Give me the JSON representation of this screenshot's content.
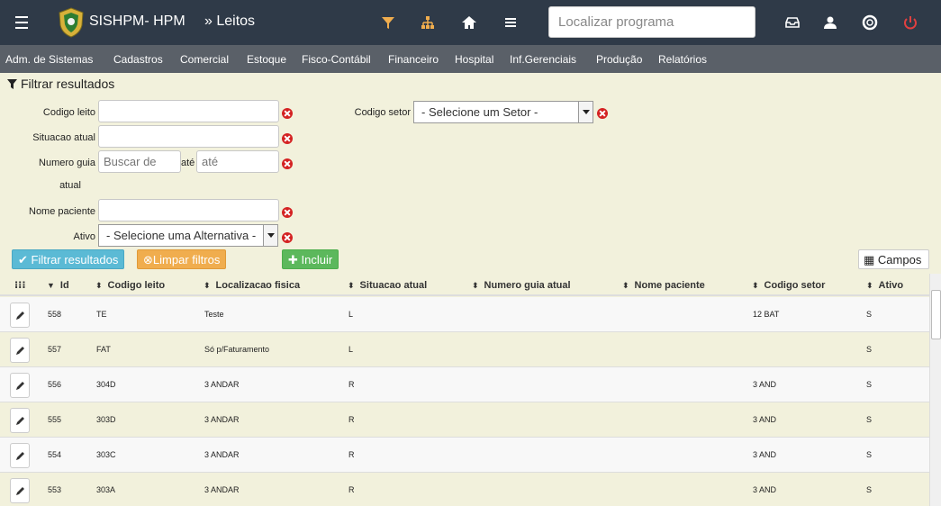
{
  "app": {
    "title": "SISHPM- HPM",
    "breadcrumb": "» Leitos"
  },
  "topbar": {
    "search_placeholder": "Localizar programa",
    "icons": [
      "filter-icon",
      "sitemap-icon",
      "home-icon",
      "list-icon",
      "inbox-icon",
      "user-icon",
      "lifebuoy-icon",
      "power-icon"
    ],
    "colors": {
      "bar": "#2f3a48",
      "accent": "#f0ad4e",
      "power": "#e04040"
    }
  },
  "nav": [
    "Adm. de Sistemas",
    "Cadastros",
    "Comercial",
    "Estoque",
    "Fisco-Contábil",
    "Financeiro",
    "Hospital",
    "Inf.Gerenciais",
    "Produção",
    "Relatórios"
  ],
  "filter": {
    "title": "Filtrar resultados",
    "codigo_leito": "Codigo leito",
    "situacao_atual": "Situacao atual",
    "numero_guia": "Numero guia",
    "numero_guia_2": "atual",
    "buscar_de_placeholder": "Buscar de",
    "ate_label": "até",
    "ate_placeholder": "até",
    "nome_paciente": "Nome paciente",
    "ativo": "Ativo",
    "ativo_select": "- Selecione uma Alternativa -",
    "codigo_setor": "Codigo setor",
    "setor_select": "- Selecione um Setor -"
  },
  "buttons": {
    "filtrar": "Filtrar resultados",
    "limpar": "Limpar filtros",
    "incluir": "Incluir",
    "campos": "Campos"
  },
  "table": {
    "headers": [
      "Id",
      "Codigo leito",
      "Localizacao fisica",
      "Situacao atual",
      "Numero guia atual",
      "Nome paciente",
      "Codigo setor",
      "Ativo"
    ],
    "rows": [
      {
        "id": "558",
        "codigo": "TE",
        "local": "Teste",
        "situacao": "L",
        "guia": "",
        "paciente": "",
        "setor": "12 BAT",
        "ativo": "S"
      },
      {
        "id": "557",
        "codigo": "FAT",
        "local": "Só p/Faturamento",
        "situacao": "L",
        "guia": "",
        "paciente": "",
        "setor": "",
        "ativo": "S"
      },
      {
        "id": "556",
        "codigo": "304D",
        "local": "3 ANDAR",
        "situacao": "R",
        "guia": "",
        "paciente": "",
        "setor": "3 AND",
        "ativo": "S"
      },
      {
        "id": "555",
        "codigo": "303D",
        "local": "3 ANDAR",
        "situacao": "R",
        "guia": "",
        "paciente": "",
        "setor": "3 AND",
        "ativo": "S"
      },
      {
        "id": "554",
        "codigo": "303C",
        "local": "3 ANDAR",
        "situacao": "R",
        "guia": "",
        "paciente": "",
        "setor": "3 AND",
        "ativo": "S"
      },
      {
        "id": "553",
        "codigo": "303A",
        "local": "3 ANDAR",
        "situacao": "R",
        "guia": "",
        "paciente": "",
        "setor": "3 AND",
        "ativo": "S"
      }
    ]
  }
}
